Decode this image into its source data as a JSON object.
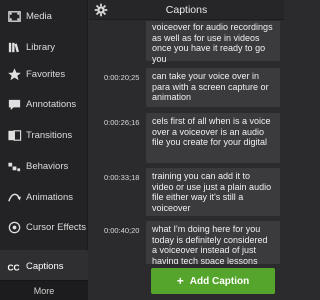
{
  "sidebar": {
    "items": [
      {
        "label": "Media",
        "icon": "film-strip-icon"
      },
      {
        "label": "Library",
        "icon": "library-books-icon"
      },
      {
        "label": "Favorites",
        "icon": "star-icon"
      },
      {
        "label": "Annotations",
        "icon": "annotation-bubble-icon"
      },
      {
        "label": "Transitions",
        "icon": "transition-icon"
      },
      {
        "label": "Behaviors",
        "icon": "behaviors-icon"
      },
      {
        "label": "Animations",
        "icon": "arrow-curve-icon"
      },
      {
        "label": "Cursor Effects",
        "icon": "cursor-target-icon"
      },
      {
        "label": "Captions",
        "icon": "cc-icon"
      }
    ],
    "more_label": "More"
  },
  "panel": {
    "title": "Captions",
    "settings_icon": "gear-icon"
  },
  "captions": [
    {
      "time": "",
      "text": "voiceover for audio recordings as well as for use in videos once you have it ready to go you"
    },
    {
      "time": "0:00:20;25",
      "text": "can take your voice over in para with a screen capture or animation"
    },
    {
      "time": "0:00:26;16",
      "text": "cels first of all when is a voice over a voiceover is an audio file you create for your digital"
    },
    {
      "time": "0:00:33;18",
      "text": "training you can add it to video or use just a plain audio file either way it's still a voiceover"
    },
    {
      "time": "0:00:40;20",
      "text": "what I'm doing here for you today is definitely considered a voiceover instead of just having tech space lessons you can add"
    }
  ],
  "add_caption_label": "Add Caption",
  "colors": {
    "sidebar_bg": "#232325",
    "panel_bg": "#2b2b2d",
    "caption_box": "#3b3b3e",
    "add_button": "#55a52c"
  }
}
